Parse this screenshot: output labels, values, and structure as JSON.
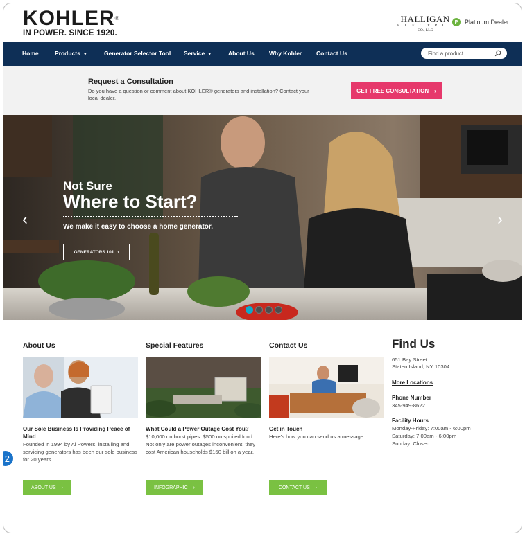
{
  "header": {
    "logo_main": "KOHLER",
    "logo_reg": "®",
    "logo_sub": "IN POWER. SINCE 1920.",
    "dealer_brand_line1": "HALLIGAN",
    "dealer_brand_line2": "E L E C T R I C",
    "dealer_brand_line3": "CO., LLC",
    "dealer_badge": "P",
    "dealer_level": "Platinum Dealer"
  },
  "nav": {
    "items": [
      {
        "label": "Home"
      },
      {
        "label": "Products",
        "caret": "▼"
      },
      {
        "label": "Generator Selector Tool"
      },
      {
        "label": "Service",
        "caret": "▼"
      },
      {
        "label": "About Us"
      },
      {
        "label": "Why Kohler"
      },
      {
        "label": "Contact Us"
      }
    ],
    "search_placeholder": "Find a product"
  },
  "consultation": {
    "title": "Request a Consultation",
    "text": "Do you have a question or comment about KOHLER® generators and installation? Contact your local dealer.",
    "button_label": "GET FREE CONSULTATION",
    "button_arrow": "›"
  },
  "hero": {
    "kicker": "Not Sure",
    "title": "Where to Start?",
    "subtitle": "We make it easy to choose a home generator.",
    "button_label": "GENERATORS 101",
    "button_arrow": "›",
    "prev": "‹",
    "next": "›",
    "slide_count": 4,
    "active_slide": 1
  },
  "columns": {
    "about": {
      "title": "About Us",
      "heading": "Our Sole Business Is Providing Peace of Mind",
      "text": "Founded in 1994 by Al Powers, installing and servicing generators has been our sole business for 20 years.",
      "button_label": "ABOUT US"
    },
    "features": {
      "title": "Special Features",
      "heading": "What Could a Power Outage Cost You?",
      "text": "$10,000 on burst pipes. $500 on spoiled food. Not only are power outages inconvenient, they cost American households $150 billion a year.",
      "button_label": "INFOGRAPHIC"
    },
    "contact": {
      "title": "Contact Us",
      "heading": "Get in Touch",
      "text": "Here's how you can send us a message.",
      "button_label": "CONTACT US"
    },
    "button_arrow": "›"
  },
  "find_us": {
    "title": "Find Us",
    "address_line1": "651 Bay Street",
    "address_line2": "Staten Island, NY 10304",
    "more_locations": "More Locations",
    "phone_label": "Phone Number",
    "phone": "345-949-8622",
    "hours_label": "Facility Hours",
    "hours": [
      "Monday-Friday: 7:00am - 6:00pm",
      "Saturday: 7:00am - 6:00pm",
      "Sunday: Closed"
    ]
  },
  "overlay_badge": "2",
  "colors": {
    "nav_bg": "#0e2f56",
    "consult_btn": "#e6386b",
    "green_btn": "#7ac142",
    "dot_active": "#11a8c8"
  }
}
